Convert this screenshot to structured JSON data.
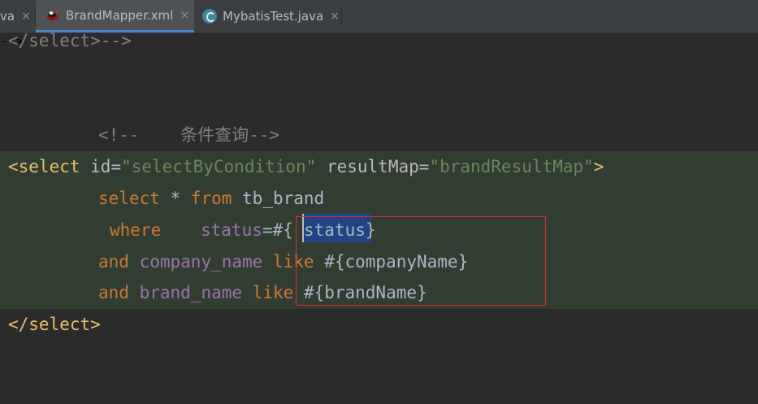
{
  "tabs": [
    {
      "label": "va",
      "icon": "java-class-icon",
      "active": false
    },
    {
      "label": "BrandMapper.xml",
      "icon": "mybatis-xml-icon",
      "active": true
    },
    {
      "label": "MybatisTest.java",
      "icon": "java-class-icon",
      "active": false
    }
  ],
  "tab_close_glyph": "×",
  "code": {
    "line1": "</select>-->",
    "comment_line": "<!--    条件查询-->",
    "select_open_tag": "<select",
    "id_attr": " id",
    "eq": "=",
    "id_value": "\"selectByCondition\"",
    "resultmap_attr": " resultMap",
    "resultmap_value": "\"brandResultMap\"",
    "close_bracket": ">",
    "kw_select": "select",
    "star": " * ",
    "kw_from": "from",
    "table": " tb_brand",
    "kw_where": "where",
    "status_field": "status",
    "status_placeholder_open": "=#{",
    "status_param": "status",
    "placeholder_close": "}",
    "kw_and": "and",
    "company_field": "company_name",
    "kw_like": "like",
    "company_placeholder": "#{companyName}",
    "brand_field": "brand_name",
    "brand_placeholder": "#{brandName}",
    "select_close_tag": "</select>"
  },
  "colors": {
    "background": "#2b2b2b",
    "tag": "#e8bf6a",
    "attribute_value": "#6a8759",
    "keyword": "#cc7832",
    "field": "#9876aa",
    "comment": "#808080",
    "selection": "#214283",
    "annotation_box": "#d83030",
    "highlight_bg": "#323d32"
  }
}
